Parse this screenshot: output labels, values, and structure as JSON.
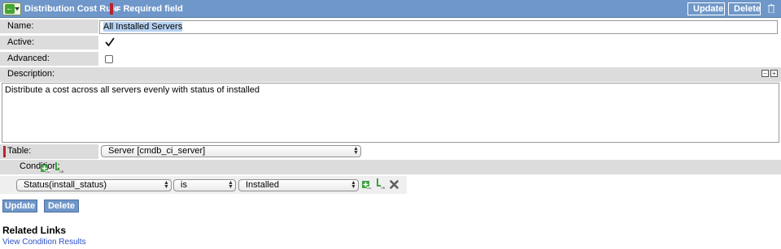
{
  "header": {
    "title": "Distribution Cost Rule",
    "required_note": "= Required field",
    "update_label": "Update",
    "delete_label": "Delete"
  },
  "form": {
    "name_label": "Name:",
    "name_value": "All Installed Servers",
    "active_label": "Active:",
    "active_checked": true,
    "advanced_label": "Advanced:",
    "advanced_checked": false,
    "description_label": "Description:",
    "description_value": "Distribute a cost across all servers evenly with status of installed",
    "table_label": "Table:",
    "table_value": "Server [cmdb_ci_server]",
    "condition_label": "Condition:"
  },
  "condition": {
    "field": "Status(install_status)",
    "operator": "is",
    "value": "Installed"
  },
  "footer": {
    "update_label": "Update",
    "delete_label": "Delete"
  },
  "related": {
    "title": "Related Links",
    "link_label": "View Condition Results"
  },
  "colors": {
    "header_bg": "#6f97c9",
    "label_bg": "#dcdcdc",
    "required_mark": "#b9232e",
    "link": "#2b4fc7"
  }
}
